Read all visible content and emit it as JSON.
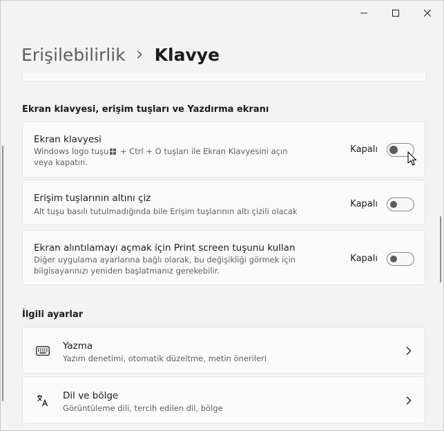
{
  "header": {
    "parent": "Erişilebilirlik",
    "current": "Klavye"
  },
  "caption": {
    "minimize_icon": "minimize-icon",
    "maximize_icon": "maximize-icon",
    "close_icon": "close-icon"
  },
  "section_keyboard": {
    "title": "Ekran klavyesi, erişim tuşları ve Yazdırma ekranı",
    "items": [
      {
        "title": "Ekran klavyesi",
        "desc_before": "Windows logo tuşu",
        "desc_after": " + Ctrl + O tuşları ile Ekran Klavyesini açın veya kapatın.",
        "state": "Kapalı",
        "on": false
      },
      {
        "title": "Erişim tuşlarının altını çiz",
        "desc": "Alt tuşu basılı tutulmadığında bile Erişim tuşlarının altı çizili olacak",
        "state": "Kapalı",
        "on": false
      },
      {
        "title": "Ekran alıntılamayı açmak için Print screen tuşunu kullan",
        "desc": "Diğer uygulama ayarlarına bağlı olarak, bu değişikliği görmek için bilgisayarınızı yeniden başlatmanız gerekebilir.",
        "state": "Kapalı",
        "on": false
      }
    ]
  },
  "section_related": {
    "title": "İlgili ayarlar",
    "items": [
      {
        "title": "Yazma",
        "desc": "Yazım denetimi, otomatik düzeltme, metin önerileri",
        "icon": "keyboard-icon"
      },
      {
        "title": "Dil ve bölge",
        "desc": "Görüntüleme dili, tercih edilen dil, bölge",
        "icon": "language-icon"
      }
    ]
  }
}
